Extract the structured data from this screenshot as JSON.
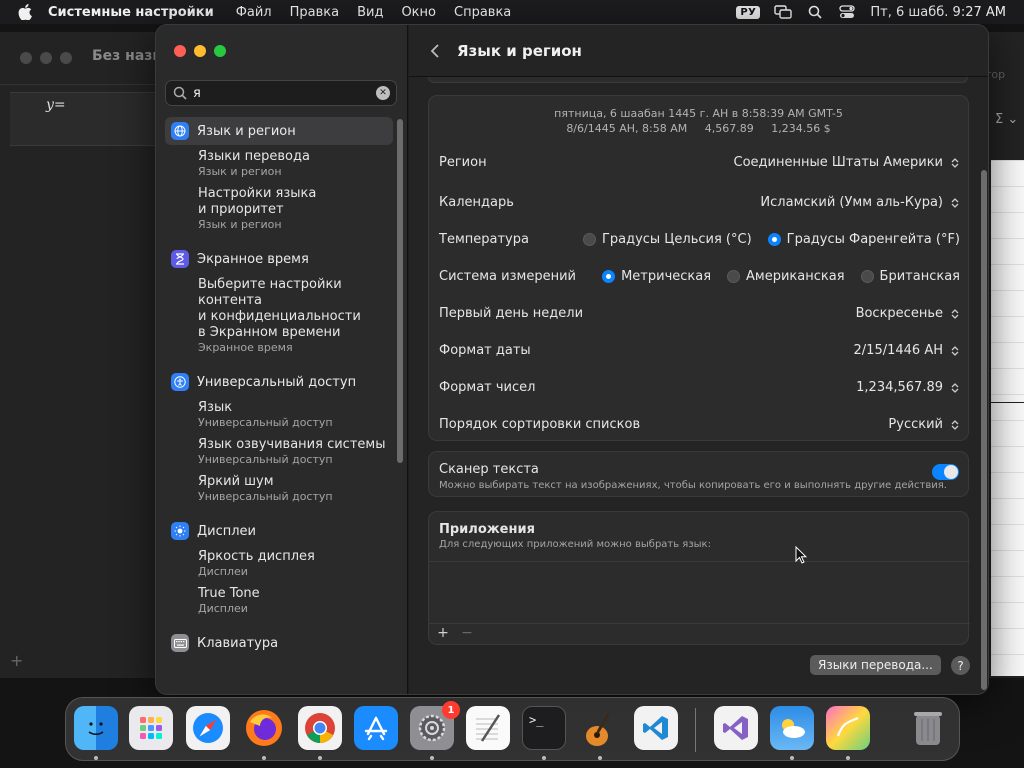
{
  "menubar": {
    "app_name": "Системные настройки",
    "items": [
      "Файл",
      "Правка",
      "Вид",
      "Окно",
      "Справка"
    ],
    "input_source": "РУ",
    "datetime": "Пт, 6 шабб. 9:27 AM"
  },
  "background_app": {
    "title": "Без назв",
    "expression": "y=",
    "toolbar_text": "тор",
    "sigma": "Σ ⌄"
  },
  "sidebar": {
    "search_value": "я",
    "groups": [
      {
        "label": "Язык и регион",
        "icon": "globe-icon",
        "color": "#2f7ff5",
        "subs": [
          {
            "title": "Языки перевода",
            "subtitle": "Язык и регион"
          },
          {
            "title": "Настройки языка",
            "title2": "и приоритет",
            "subtitle": "Язык и регион"
          }
        ]
      },
      {
        "label": "Экранное время",
        "icon": "hourglass-icon",
        "color": "#5e5ce6",
        "subs": [
          {
            "title": "Выберите настройки",
            "title2": "контента",
            "title3": "и конфиденциальности",
            "title4": "в Экранном времени",
            "subtitle": "Экранное время"
          }
        ]
      },
      {
        "label": "Универсальный доступ",
        "icon": "accessibility-icon",
        "color": "#2f7ff5",
        "subs": [
          {
            "title": "Язык",
            "subtitle": "Универсальный доступ"
          },
          {
            "title": "Язык озвучивания системы",
            "subtitle": "Универсальный доступ"
          },
          {
            "title": "Яркий шум",
            "subtitle": "Универсальный доступ"
          }
        ]
      },
      {
        "label": "Дисплеи",
        "icon": "sun-icon",
        "color": "#2f7ff5",
        "subs": [
          {
            "title": "Яркость дисплея",
            "subtitle": "Дисплеи"
          },
          {
            "title": "True Tone",
            "subtitle": "Дисплеи"
          }
        ]
      },
      {
        "label": "Клавиатура",
        "icon": "keyboard-icon",
        "color": "#8e8e93",
        "subs": []
      }
    ]
  },
  "content": {
    "title": "Язык и регион",
    "preview_line1": "пятница, 6 шаабан 1445 г. AH в 8:58:39 AM GMT-5",
    "preview_line2": [
      "8/6/1445 AH, 8:58 AM",
      "4,567.89",
      "1,234.56 $"
    ],
    "rows": {
      "region": {
        "label": "Регион",
        "value": "Соединенные Штаты Америки"
      },
      "calendar": {
        "label": "Календарь",
        "value": "Исламский (Умм аль-Кура)"
      },
      "temperature": {
        "label": "Температура",
        "options": [
          "Градусы Цельсия (°C)",
          "Градусы Фаренгейта (°F)"
        ],
        "selected": 1
      },
      "measurement": {
        "label": "Система измерений",
        "options": [
          "Метрическая",
          "Американская",
          "Британская"
        ],
        "selected": 0
      },
      "first_day": {
        "label": "Первый день недели",
        "value": "Воскресенье"
      },
      "date_format": {
        "label": "Формат даты",
        "value": "2/15/1446 AH"
      },
      "number_format": {
        "label": "Формат чисел",
        "value": "1,234,567.89"
      },
      "sort_order": {
        "label": "Порядок сортировки списков",
        "value": "Русский"
      }
    },
    "scanner": {
      "title": "Сканер текста",
      "subtitle": "Можно выбирать текст на изображениях, чтобы копировать его и выполнять другие действия.",
      "enabled": true
    },
    "apps": {
      "title": "Приложения",
      "subtitle": "Для следующих приложений можно выбрать язык:",
      "add": "+",
      "remove": "−"
    },
    "translation_button": "Языки перевода...",
    "help_button": "?"
  },
  "dock": {
    "items": [
      "finder-icon",
      "launchpad-icon",
      "safari-icon",
      "firefox-icon",
      "chrome-icon",
      "app-store-icon",
      "system-settings-icon",
      "textedit-icon",
      "terminal-icon",
      "garageband-icon",
      "vscode-icon",
      "visual-studio-icon",
      "weather-icon",
      "graph-icon",
      "trash-icon"
    ],
    "settings_badge": "1"
  }
}
